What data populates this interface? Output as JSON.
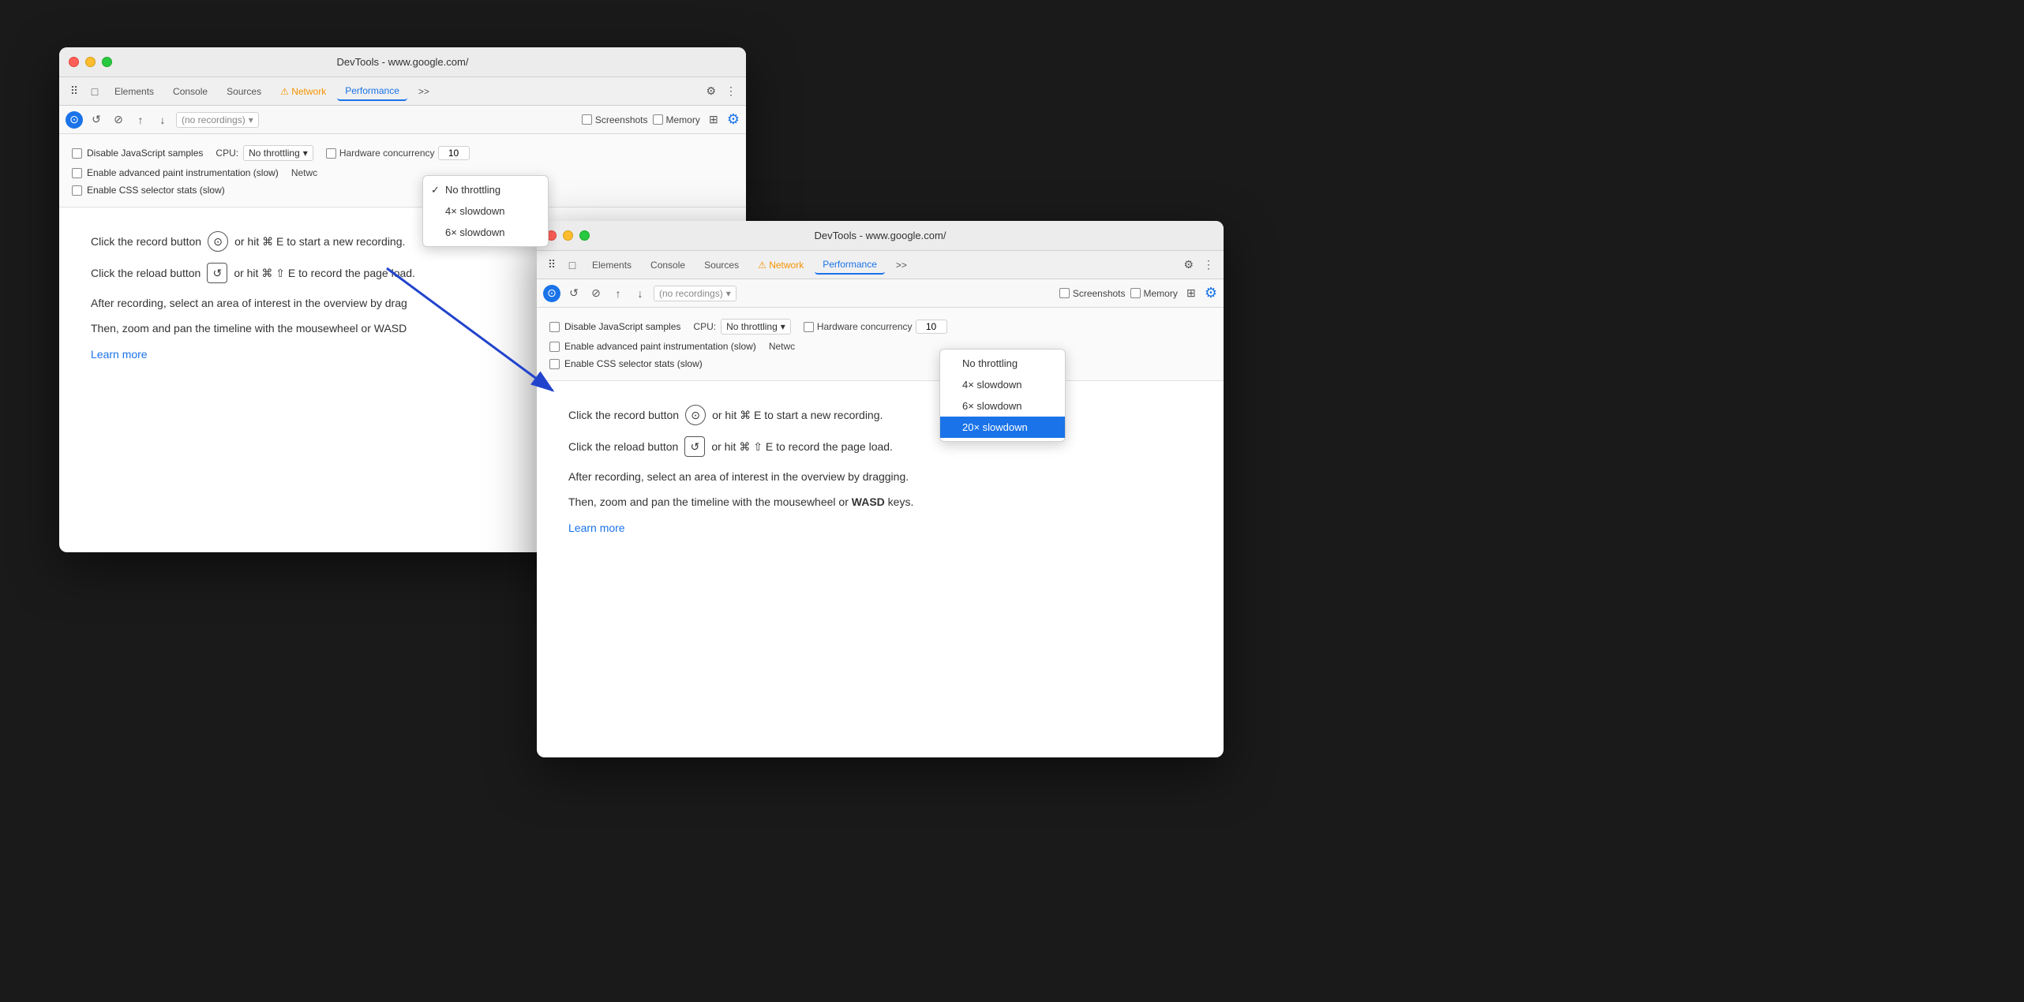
{
  "back_window": {
    "title": "DevTools - www.google.com/",
    "tabs": [
      "Elements",
      "Console",
      "Sources",
      "Network",
      "Performance",
      ">>"
    ],
    "recordings_placeholder": "(no recordings)",
    "screenshots_label": "Screenshots",
    "memory_label": "Memory",
    "cpu_label": "CPU:",
    "network_label": "Netwc",
    "hardware_label": "Hardware concurrency",
    "hw_value": "10",
    "disable_js_label": "Disable JavaScript samples",
    "enable_paint_label": "Enable advanced paint instrumentation (slow)",
    "enable_css_label": "Enable CSS selector stats (slow)",
    "dropdown": {
      "items": [
        {
          "label": "No throttling",
          "checked": true
        },
        {
          "label": "4× slowdown",
          "checked": false
        },
        {
          "label": "6× slowdown",
          "checked": false
        }
      ]
    },
    "instructions": {
      "record_text": "Click the record button",
      "record_shortcut": " or hit ⌘ E to start a new recording.",
      "reload_text": "Click the reload button",
      "reload_shortcut": " or hit ⌘ ⇧ E to record the page load.",
      "description": "After recording, select an area of interest in the overview by drag",
      "description2": "Then, zoom and pan the timeline with the mousewheel or WASD",
      "learn_more": "Learn more"
    }
  },
  "front_window": {
    "title": "DevTools - www.google.com/",
    "tabs": [
      "Elements",
      "Console",
      "Sources",
      "Network",
      "Performance",
      ">>"
    ],
    "recordings_placeholder": "(no recordings)",
    "screenshots_label": "Screenshots",
    "memory_label": "Memory",
    "cpu_label": "CPU:",
    "network_label": "Netwc",
    "hardware_label": "Hardware concurrency",
    "hw_value": "10",
    "disable_js_label": "Disable JavaScript samples",
    "enable_paint_label": "Enable advanced paint instrumentation (slow)",
    "enable_css_label": "Enable CSS selector stats (slow)",
    "dropdown": {
      "items": [
        {
          "label": "No throttling",
          "checked": false
        },
        {
          "label": "4× slowdown",
          "checked": false
        },
        {
          "label": "6× slowdown",
          "checked": false
        },
        {
          "label": "20× slowdown",
          "checked": false,
          "highlighted": true
        }
      ]
    },
    "instructions": {
      "record_text": "Click the record button",
      "record_shortcut": " or hit ⌘ E to start a new recording.",
      "reload_text": "Click the reload button",
      "reload_shortcut": " or hit ⌘ ⇧ E to record the page load.",
      "description": "After recording, select an area of interest in the overview by dragging.",
      "description2": "Then, zoom and pan the timeline with the mousewheel or ",
      "description2_bold": "WASD",
      "description2_end": " keys.",
      "learn_more": "Learn more"
    }
  },
  "arrow": {
    "color": "#2244cc"
  }
}
